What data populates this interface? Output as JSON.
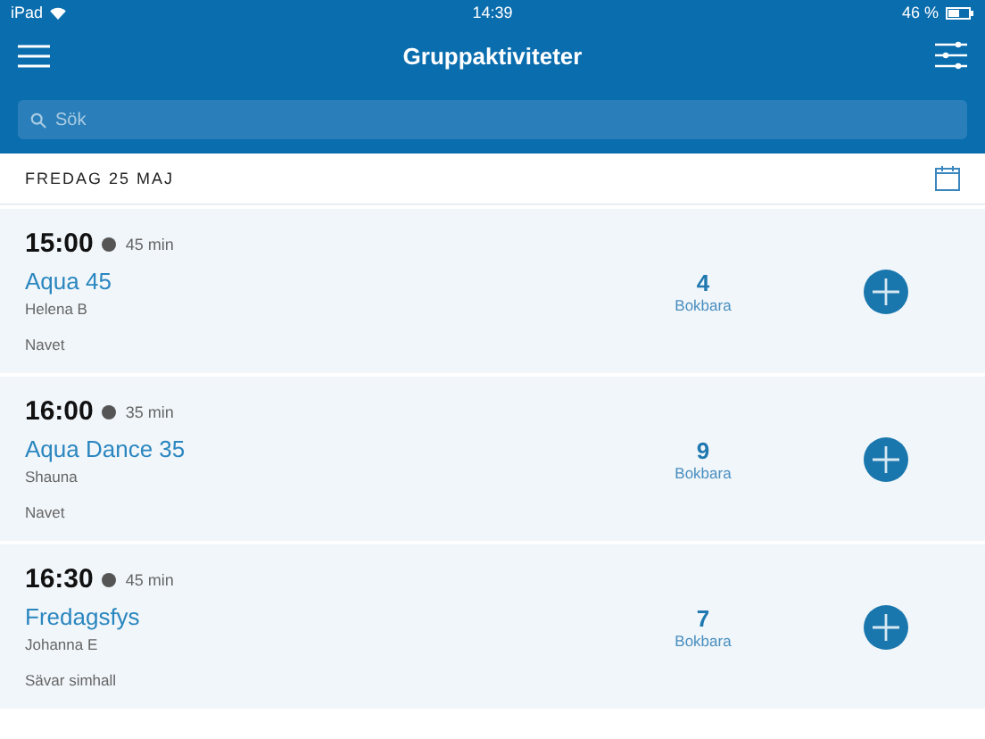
{
  "status_bar": {
    "device": "iPad",
    "time": "14:39",
    "battery": "46 %"
  },
  "header": {
    "title": "Gruppaktiviteter"
  },
  "search": {
    "placeholder": "Sök"
  },
  "date": "FREDAG 25 MAJ",
  "activities": [
    {
      "time": "15:00",
      "duration": "45 min",
      "name": "Aqua 45",
      "instructor": "Helena B",
      "location": "Navet",
      "count": "4",
      "count_label": "Bokbara"
    },
    {
      "time": "16:00",
      "duration": "35 min",
      "name": "Aqua Dance 35",
      "instructor": "Shauna",
      "location": "Navet",
      "count": "9",
      "count_label": "Bokbara"
    },
    {
      "time": "16:30",
      "duration": "45 min",
      "name": "Fredagsfys",
      "instructor": "Johanna E",
      "location": "Sävar simhall",
      "count": "7",
      "count_label": "Bokbara"
    }
  ]
}
